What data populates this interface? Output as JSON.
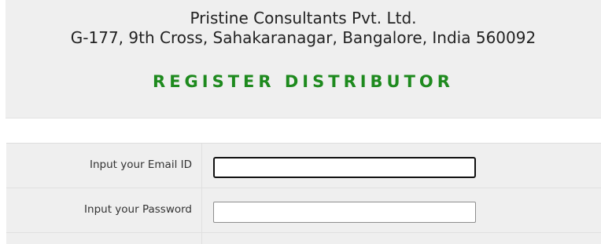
{
  "header": {
    "company_name": "Pristine Consultants Pvt. Ltd.",
    "company_address": "G-177, 9th Cross, Sahakaranagar, Bangalore, India 560092",
    "page_title": "REGISTER DISTRIBUTOR",
    "title_color": "#1e8a1e"
  },
  "form": {
    "email": {
      "label": "Input your Email ID",
      "value": "",
      "focused": true
    },
    "password": {
      "label": "Input your Password",
      "value": ""
    }
  }
}
